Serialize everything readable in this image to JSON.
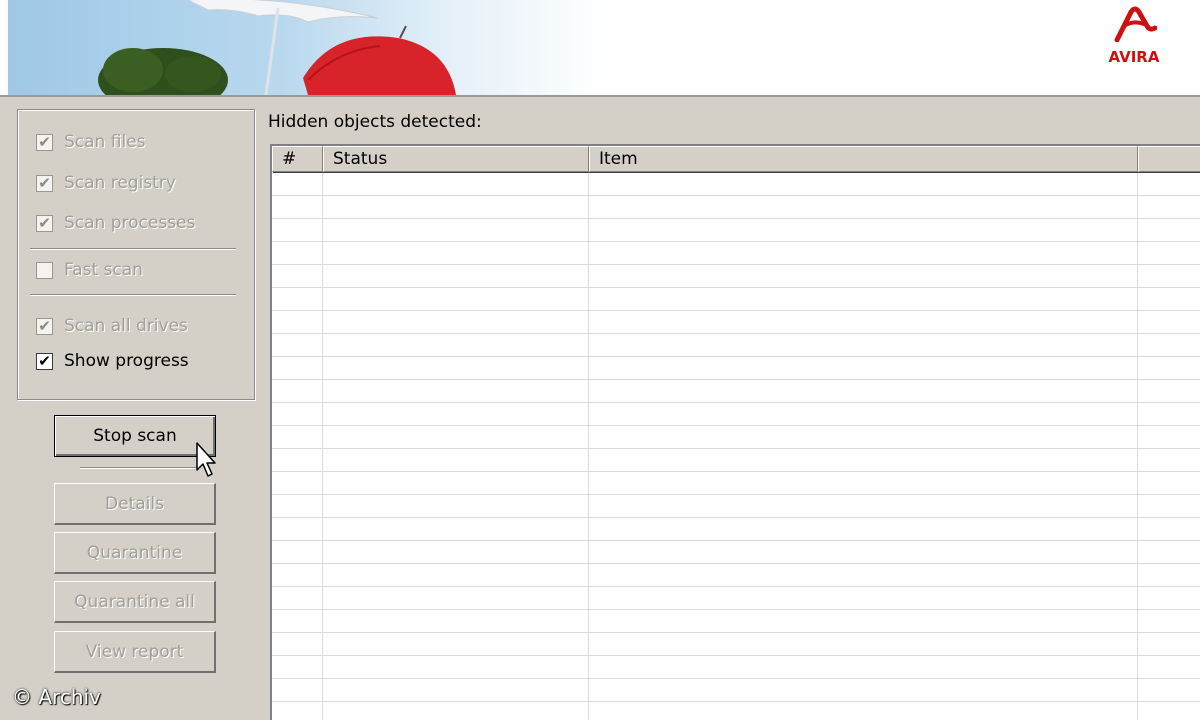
{
  "branding": {
    "logo_text": "AVIRA",
    "brand_color": "#cc1010"
  },
  "options": {
    "scan_files": {
      "label": "Scan files",
      "checked": true,
      "enabled": false
    },
    "scan_registry": {
      "label": "Scan registry",
      "checked": true,
      "enabled": false
    },
    "scan_processes": {
      "label": "Scan processes",
      "checked": true,
      "enabled": false
    },
    "fast_scan": {
      "label": "Fast scan",
      "checked": false,
      "enabled": false
    },
    "scan_all_drives": {
      "label": "Scan all drives",
      "checked": true,
      "enabled": false
    },
    "show_progress": {
      "label": "Show progress",
      "checked": true,
      "enabled": true
    }
  },
  "buttons": {
    "stop_scan": "Stop scan",
    "details": "Details",
    "quarantine": "Quarantine",
    "quarantine_all": "Quarantine all",
    "view_report": "View report"
  },
  "results": {
    "title": "Hidden objects detected:",
    "columns": [
      "#",
      "Status",
      "Item",
      ""
    ],
    "rows": []
  },
  "watermark": "© Archiv",
  "icons": {
    "check": "✔",
    "cursor": "arrow-pointer-icon",
    "logo": "avira-umbrella-logo-icon"
  }
}
